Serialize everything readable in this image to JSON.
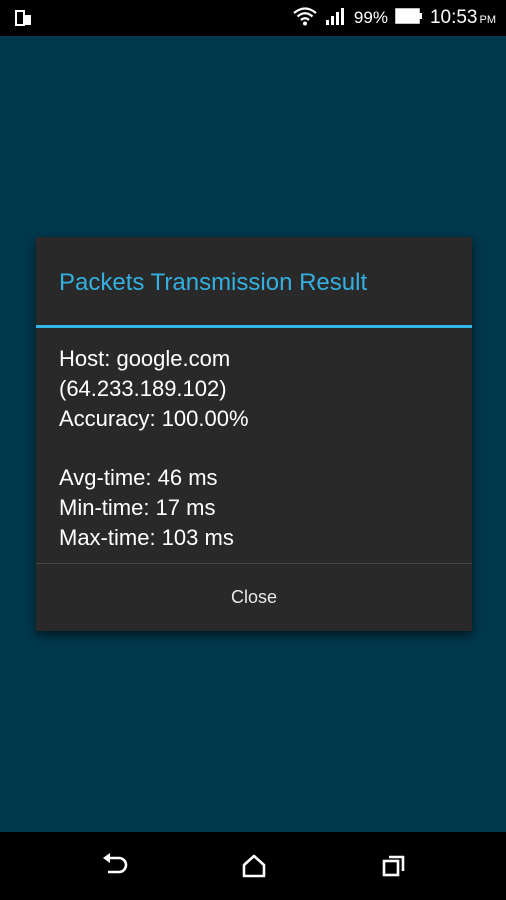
{
  "status_bar": {
    "battery_percent": "99%",
    "time": "10:53",
    "ampm": "PM"
  },
  "dialog": {
    "title": "Packets Transmission Result",
    "host": "Host: google.com",
    "ip": "(64.233.189.102)",
    "accuracy": "Accuracy: 100.00%",
    "avg_time": "Avg-time: 46 ms",
    "min_time": "Min-time: 17 ms",
    "max_time": "Max-time: 103 ms",
    "close_label": "Close"
  },
  "icons": {
    "status_left": "screen-mirror-icon",
    "wifi": "wifi-icon",
    "signal": "signal-icon",
    "battery": "battery-icon",
    "nav_back": "back-icon",
    "nav_home": "home-icon",
    "nav_recents": "recents-icon"
  },
  "colors": {
    "background": "#01384d",
    "dialog": "#292929",
    "accent": "#33b5e5"
  }
}
